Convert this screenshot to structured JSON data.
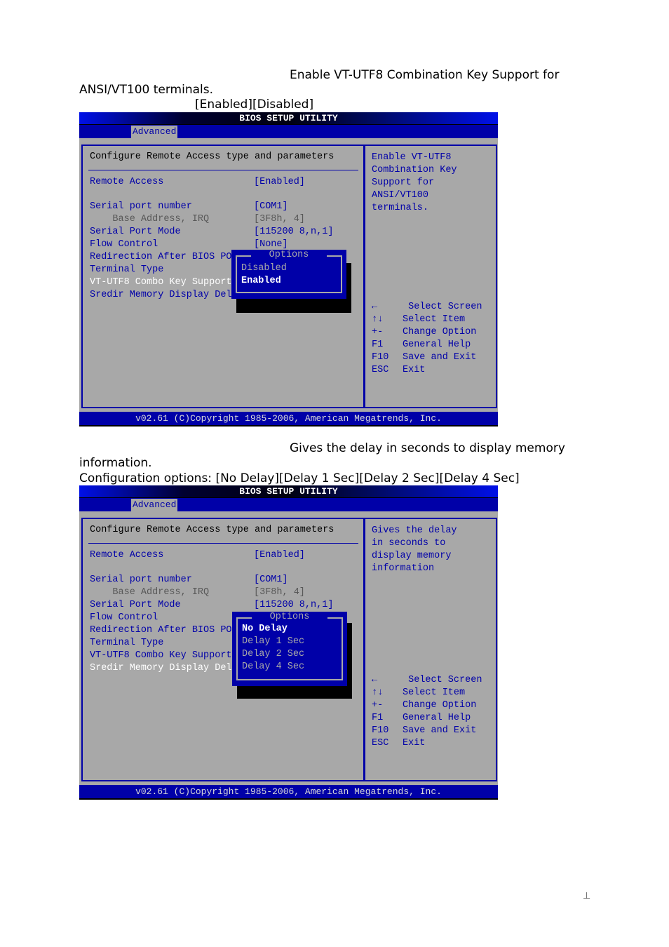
{
  "doc": {
    "section1": {
      "desc_line1": "Enable VT-UTF8 Combination Key Support for",
      "desc_line2": "ANSI/VT100 terminals.",
      "options_line": "[Enabled][Disabled]"
    },
    "section2": {
      "desc_line1": "Gives the delay in seconds to display memory",
      "desc_line2": "information.",
      "options_line": "Configuration options: [No Delay][Delay 1 Sec][Delay 2 Sec][Delay 4 Sec]"
    },
    "page_mark": "⊥"
  },
  "screens": [
    {
      "title": "BIOS SETUP UTILITY",
      "tab": "Advanced",
      "section_title": "Configure Remote Access type and parameters",
      "items": [
        {
          "label": "Remote Access",
          "value": "[Enabled]"
        },
        {
          "label": "Serial port number",
          "value": "[COM1]"
        },
        {
          "label": "    Base Address, IRQ",
          "value": "[3F8h, 4]"
        },
        {
          "label": "Serial Port Mode",
          "value": "[115200 8,n,1]"
        },
        {
          "label": "Flow Control",
          "value": "[None]"
        },
        {
          "label": "Redirection After BIOS POST",
          "value": ""
        },
        {
          "label": "Terminal Type",
          "value": ""
        },
        {
          "label": "VT-UTF8 Combo Key Support",
          "value": ""
        },
        {
          "label": "Sredir Memory Display Delay",
          "value": ""
        }
      ],
      "help_lines": [
        "Enable VT-UTF8",
        "Combination Key",
        "Support for ANSI/VT100",
        "terminals."
      ],
      "popup": {
        "title": "Options",
        "options": [
          "Disabled",
          "Enabled"
        ],
        "selected": "Enabled"
      },
      "keys": [
        {
          "key": "←",
          "desc": " Select Screen"
        },
        {
          "key": "↑↓",
          "desc": "Select Item"
        },
        {
          "key": "+-",
          "desc": "Change Option"
        },
        {
          "key": "F1",
          "desc": "General Help"
        },
        {
          "key": "F10",
          "desc": "Save and Exit"
        },
        {
          "key": "ESC",
          "desc": "Exit"
        }
      ],
      "footer": "v02.61 (C)Copyright 1985-2006, American Megatrends, Inc."
    },
    {
      "title": "BIOS SETUP UTILITY",
      "tab": "Advanced",
      "section_title": "Configure Remote Access type and parameters",
      "items": [
        {
          "label": "Remote Access",
          "value": "[Enabled]"
        },
        {
          "label": "Serial port number",
          "value": "[COM1]"
        },
        {
          "label": "    Base Address, IRQ",
          "value": "[3F8h, 4]"
        },
        {
          "label": "Serial Port Mode",
          "value": "[115200 8,n,1]"
        },
        {
          "label": "Flow Control",
          "value": ""
        },
        {
          "label": "Redirection After BIOS POST",
          "value": ""
        },
        {
          "label": "Terminal Type",
          "value": ""
        },
        {
          "label": "VT-UTF8 Combo Key Support",
          "value": ""
        },
        {
          "label": "Sredir Memory Display Delay",
          "value": ""
        }
      ],
      "help_lines": [
        "Gives the delay",
        "in seconds to",
        "display memory",
        "information"
      ],
      "popup": {
        "title": "Options",
        "options": [
          "No Delay",
          "Delay 1 Sec",
          "Delay 2 Sec",
          "Delay 4 Sec"
        ],
        "selected": "No Delay"
      },
      "keys": [
        {
          "key": "←",
          "desc": " Select Screen"
        },
        {
          "key": "↑↓",
          "desc": "Select Item"
        },
        {
          "key": "+-",
          "desc": "Change Option"
        },
        {
          "key": "F1",
          "desc": "General Help"
        },
        {
          "key": "F10",
          "desc": "Save and Exit"
        },
        {
          "key": "ESC",
          "desc": "Exit"
        }
      ],
      "footer": "v02.61 (C)Copyright 1985-2006, American Megatrends, Inc."
    }
  ]
}
